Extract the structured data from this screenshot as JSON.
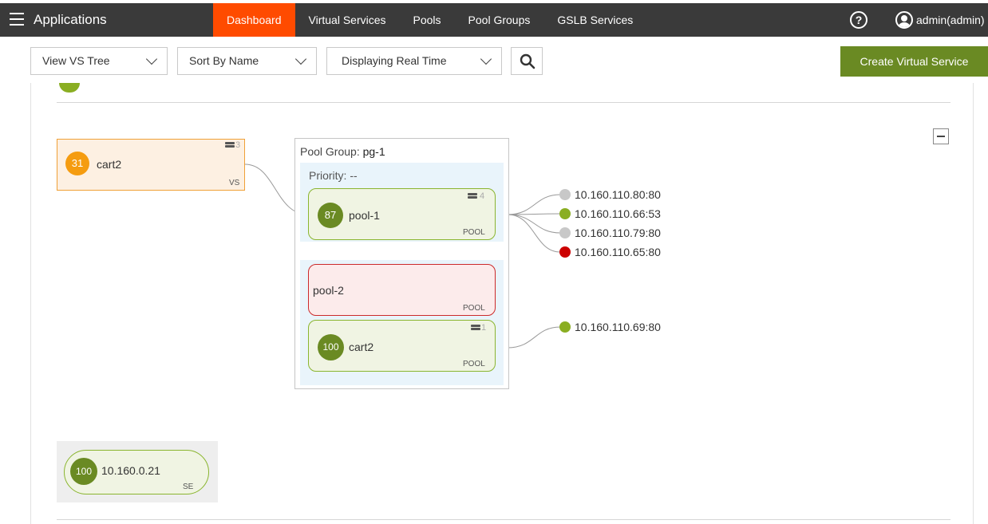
{
  "header": {
    "app_title": "Applications",
    "nav": [
      "Dashboard",
      "Virtual Services",
      "Pools",
      "Pool Groups",
      "GSLB Services"
    ],
    "help_label": "?",
    "user_label": "admin(admin)"
  },
  "toolbar": {
    "view_select": "View VS Tree",
    "sort_select": "Sort By Name",
    "display_select": "Displaying Real Time",
    "create_button": "Create Virtual Service"
  },
  "vs": {
    "score": "31",
    "name": "cart2",
    "type": "VS",
    "se_count": "3",
    "badge_color": "#f59c10"
  },
  "pool_group": {
    "title_prefix": "Pool Group: ",
    "name": "pg-1",
    "priority_label": "Priority: --",
    "pools": [
      {
        "score": "87",
        "name": "pool-1",
        "type": "POOL",
        "server_count": "4"
      },
      {
        "score": "",
        "name": "pool-2",
        "type": "POOL",
        "server_count": ""
      },
      {
        "score": "100",
        "name": "cart2",
        "type": "POOL",
        "server_count": "1"
      }
    ]
  },
  "members_pool1": [
    {
      "addr": "10.160.110.80:80",
      "color": "#c8c8c8"
    },
    {
      "addr": "10.160.110.66:53",
      "color": "#8aae22"
    },
    {
      "addr": "10.160.110.79:80",
      "color": "#c8c8c8"
    },
    {
      "addr": "10.160.110.65:80",
      "color": "#cc0000"
    }
  ],
  "members_pool3": [
    {
      "addr": "10.160.110.69:80",
      "color": "#8aae22"
    }
  ],
  "se": {
    "score": "100",
    "name": "10.160.0.21",
    "type": "SE"
  },
  "colors": {
    "accent": "#ff4b00",
    "healthy": "#6a8a23",
    "topbar": "#3a3a3a"
  }
}
